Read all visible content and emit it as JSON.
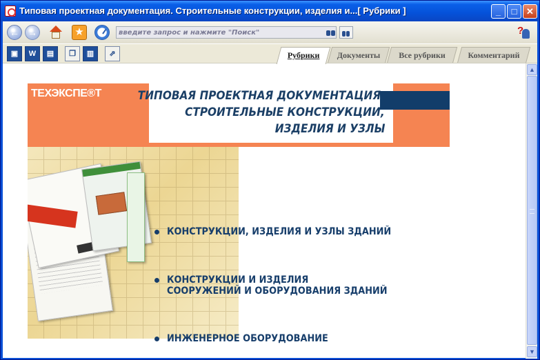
{
  "window": {
    "title": "Типовая проектная документация. Строительные конструкции, изделия и...[ Рубрики ]",
    "buttons": {
      "minimize": "_",
      "maximize": "□",
      "close": "✕"
    }
  },
  "toolbar": {
    "search_placeholder": "введите запрос и нажмите \"Поиск\""
  },
  "tabs": [
    "Рубрики",
    "Документы",
    "Все рубрики",
    "Комментарий"
  ],
  "banner": {
    "logo": "ТЕХЭКСПЕ®Т",
    "title_lines": [
      "ТИПОВАЯ ПРОЕКТНАЯ ДОКУМЕНТАЦИЯ.",
      "СТРОИТЕЛЬНЫЕ КОНСТРУКЦИИ,",
      "ИЗДЕЛИЯ И УЗЛЫ"
    ]
  },
  "rubrics": [
    {
      "line1": "КОНСТРУКЦИИ, ИЗДЕЛИЯ И УЗЛЫ ЗДАНИЙ",
      "line2": ""
    },
    {
      "line1": "КОНСТРУКЦИИ И ИЗДЕЛИЯ",
      "line2": "СООРУЖЕНИЙ И ОБОРУДОВАНИЯ ЗДАНИЙ"
    },
    {
      "line1": "ИНЖЕНЕРНОЕ ОБОРУДОВАНИЕ",
      "line2": ""
    }
  ],
  "colors": {
    "accent_orange": "#f58452",
    "navy": "#173e6b",
    "titlebar_blue": "#0a5fe8"
  }
}
